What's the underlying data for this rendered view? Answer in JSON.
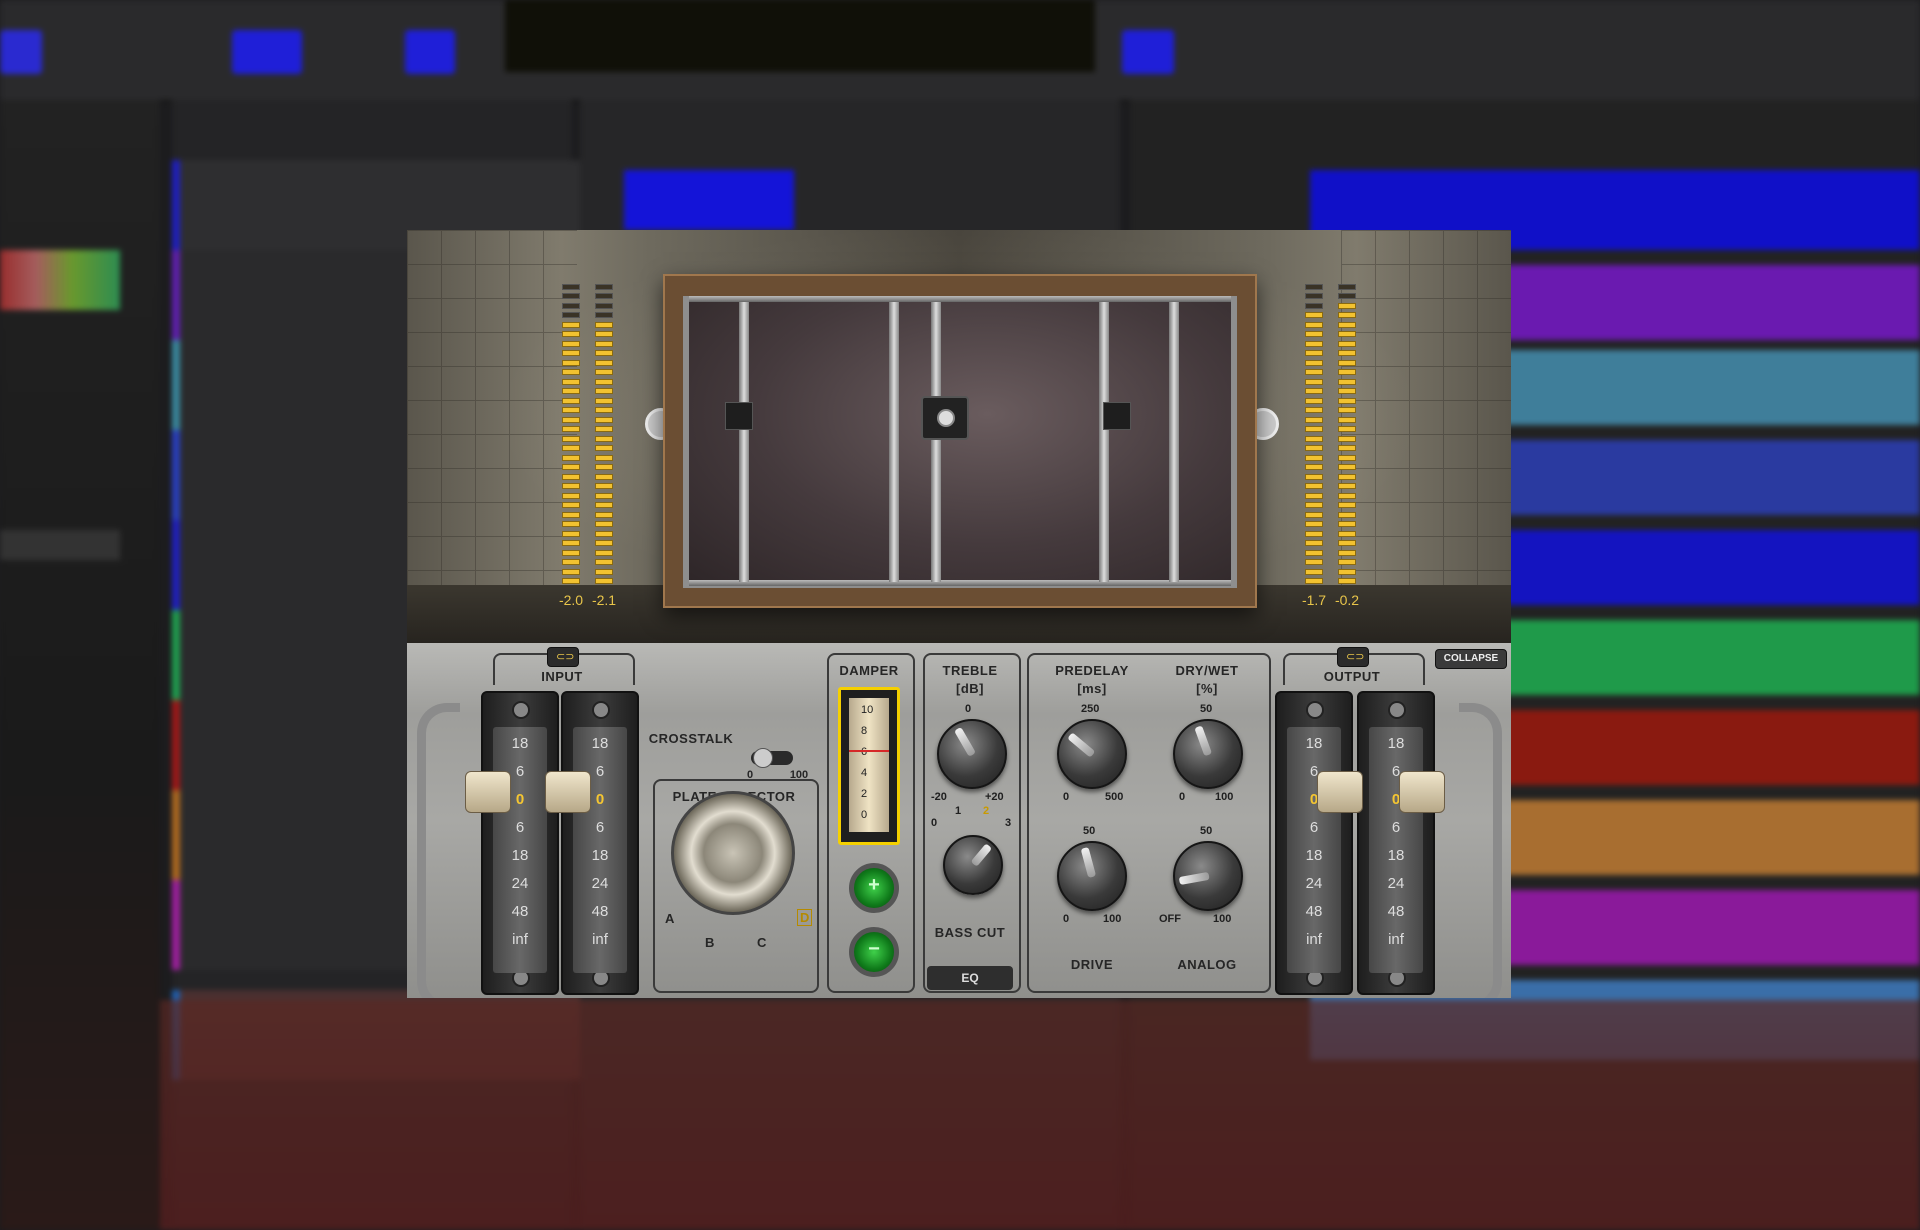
{
  "plugin": {
    "meters": {
      "input_left": "-2.0",
      "input_right": "-2.1",
      "output_left": "-1.7",
      "output_right": "-0.2"
    },
    "input_label": "INPUT",
    "output_label": "OUTPUT",
    "collapse_label": "COLLAPSE",
    "fader_scale": [
      "18",
      "6",
      "0",
      "6",
      "18",
      "24",
      "48",
      "inf"
    ],
    "crosstalk": {
      "label": "CROSSTALK",
      "min": "0",
      "max": "100"
    },
    "plate_selector": {
      "label": "PLATE SELECTOR",
      "options": [
        "A",
        "B",
        "C",
        "D"
      ],
      "selected": "D"
    },
    "damper": {
      "label": "DAMPER",
      "scale": [
        "10",
        "8",
        "6",
        "4",
        "2",
        "0"
      ]
    },
    "treble": {
      "label": "TREBLE",
      "unit": "[dB]",
      "top": "0",
      "min": "-20",
      "max": "+20"
    },
    "bass_cut": {
      "label": "BASS CUT",
      "scale": [
        "0",
        "1",
        "2",
        "3"
      ],
      "selected": "2"
    },
    "eq_label": "EQ",
    "predelay": {
      "label": "PREDELAY",
      "unit": "[ms]",
      "top": "250",
      "min": "0",
      "max": "500"
    },
    "dry_wet": {
      "label": "DRY/WET",
      "unit": "[%]",
      "top": "50",
      "min": "0",
      "max": "100"
    },
    "drive": {
      "label": "DRIVE",
      "top": "50",
      "min": "0",
      "max": "100"
    },
    "analog": {
      "label": "ANALOG",
      "top": "50",
      "min": "OFF",
      "max": "100"
    },
    "plus_label": "+",
    "minus_label": "−"
  },
  "colors": {
    "accent": "#f5c631",
    "meter": "#e8c54a"
  }
}
